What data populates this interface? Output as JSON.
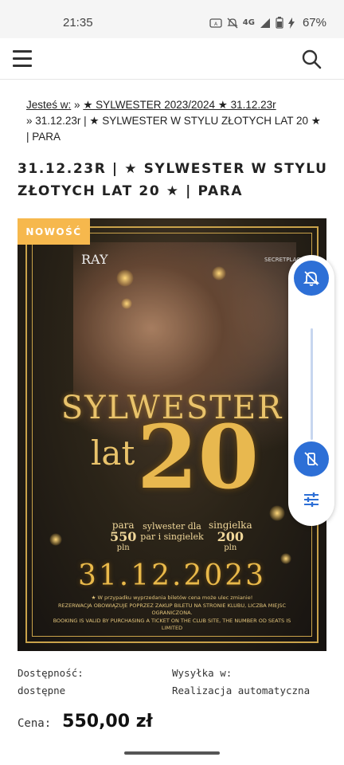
{
  "status_bar": {
    "time": "21:35",
    "network": "4G",
    "battery": "67%"
  },
  "header": {
    "menu_icon": "hamburger-icon",
    "search_icon": "search-icon"
  },
  "breadcrumb": {
    "prefix": "Jesteś w:",
    "sep": "»",
    "category": "★ SYLWESTER 2023/2024 ★ 31.12.23r",
    "current": "31.12.23r | ★ SYLWESTER W STYLU ZŁOTYCH LAT 20 ★ | PARA"
  },
  "product": {
    "title": "31.12.23R | ★ SYLWESTER W STYLU ZŁOTYCH LAT 20 ★ | PARA",
    "badge": "NOWOŚĆ",
    "poster": {
      "logo_left": "RAY",
      "logo_right": "SECRETPLACE",
      "headline": "SYLWESTER",
      "lat": "lat",
      "number": "20",
      "pair_label": "para",
      "pair_price": "550",
      "pair_unit": "pln",
      "middle_text": "sylwester dla par i singielek",
      "single_label": "singielka",
      "single_price": "200",
      "single_unit": "pln",
      "date": "31.12.2023",
      "note1": "★ W przypadku wyprzedania biletów cena może ulec zmianie!",
      "note2": "REZERWACJA OBOWIĄZUJE POPRZEZ ZAKUP BILETU NA STRONIE KLUBU, LICZBA MIEJSC OGRANICZONA.",
      "note3": "BOOKING IS VALID BY PURCHASING A TICKET ON THE CLUB SITE, THE NUMBER OD SEATS IS LIMITED"
    },
    "availability_label": "Dostępność:",
    "availability_value": "dostępne",
    "shipping_label": "Wysyłka w:",
    "shipping_value": "Realizacja automatyczna",
    "price_label": "Cena:",
    "price_value": "550,00 zł"
  },
  "volume_panel": {
    "top_icon": "bell-off-icon",
    "bottom_icon": "vibrate-off-icon",
    "settings_icon": "equalizer-icon"
  }
}
